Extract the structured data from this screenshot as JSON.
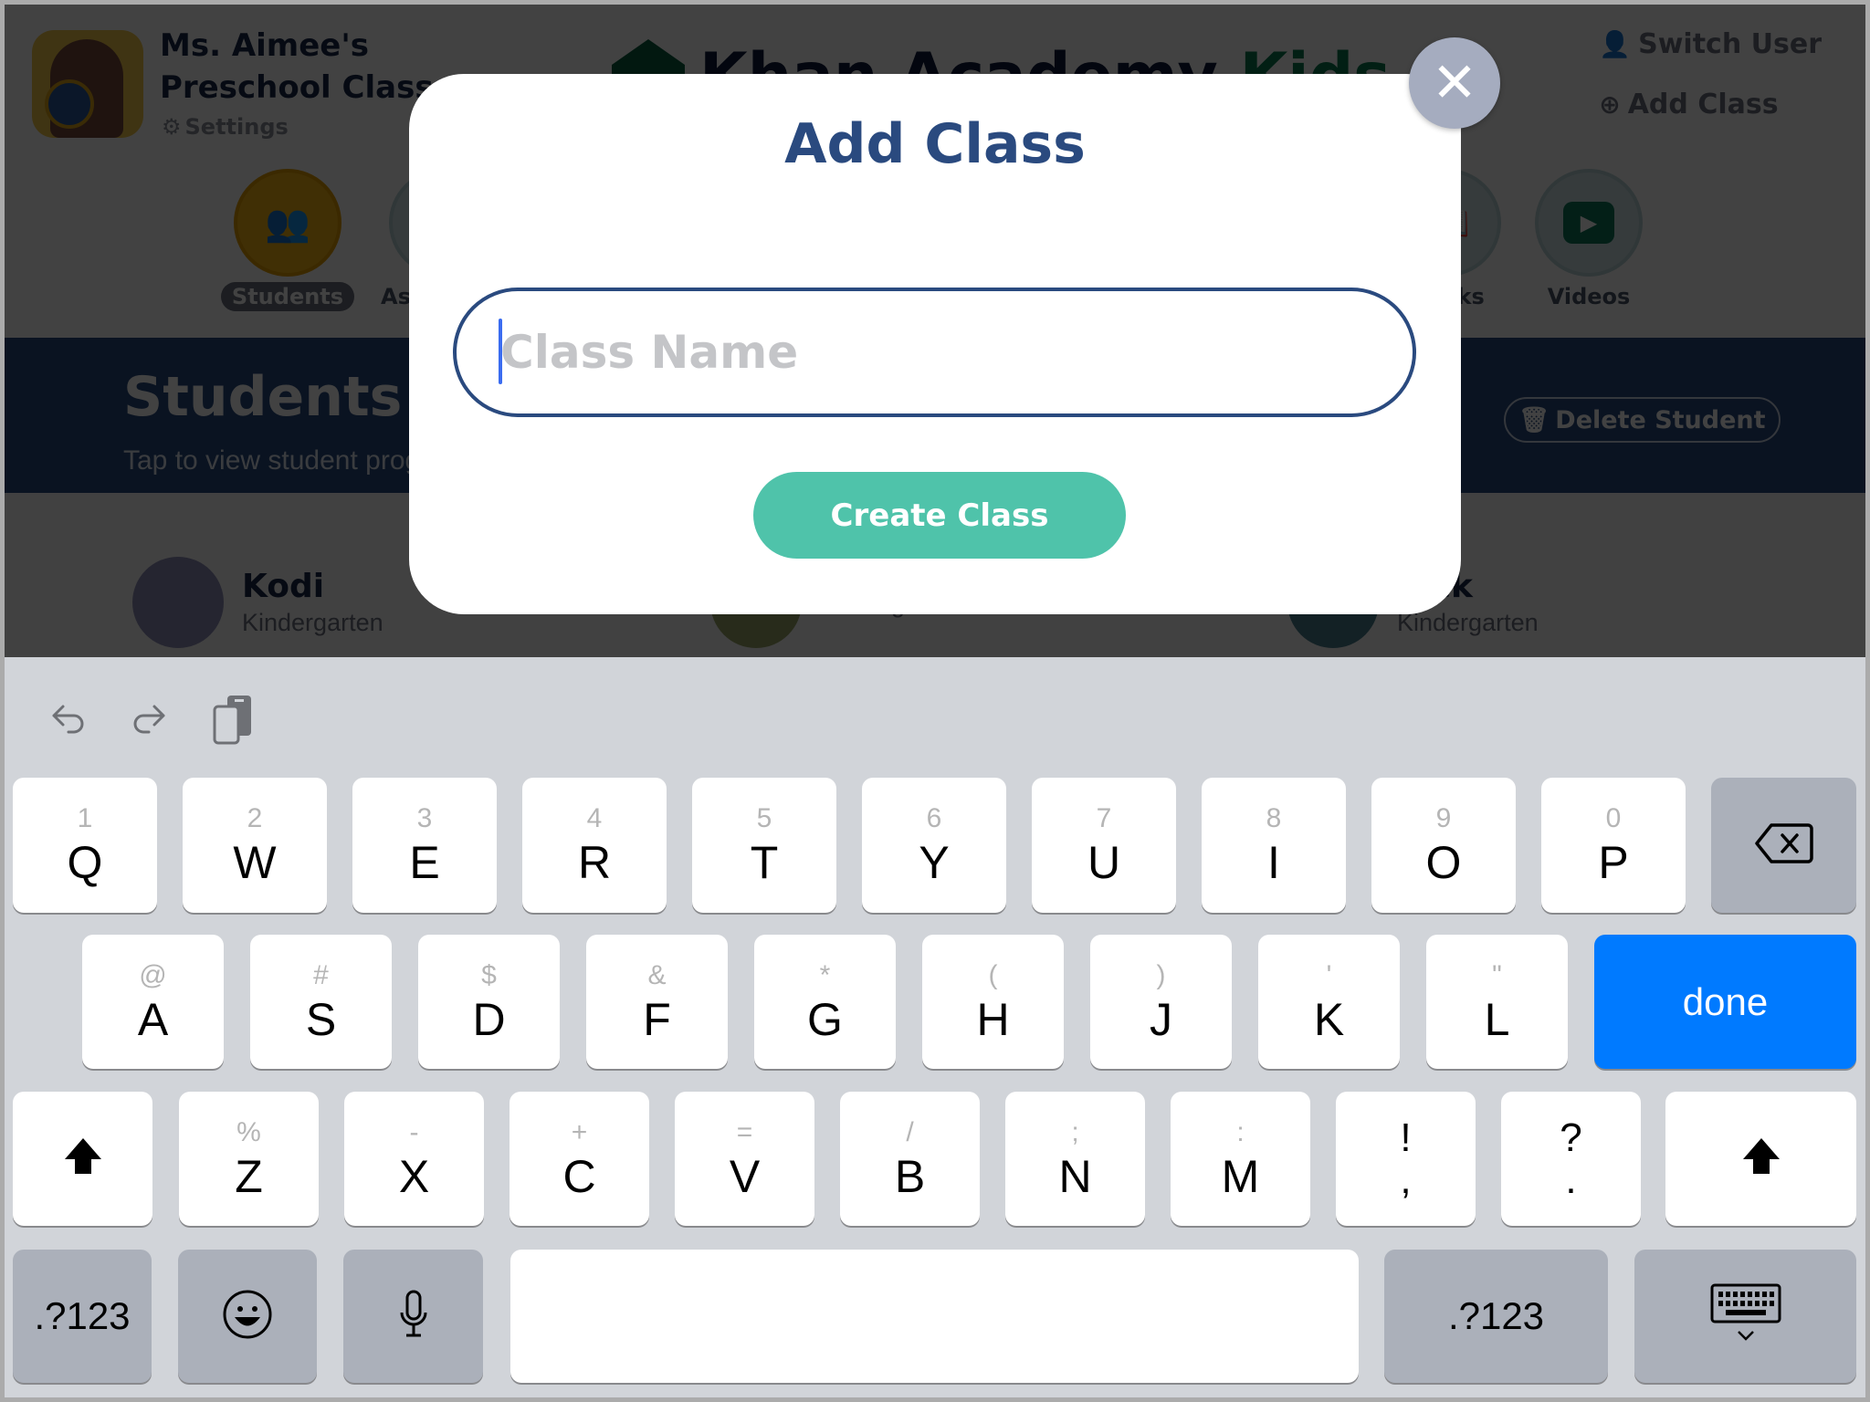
{
  "app": {
    "class_name_line1": "Ms. Aimee's",
    "class_name_line2": "Preschool Class",
    "settings_label": "Settings",
    "logo_primary": "Khan Academy",
    "logo_secondary": "Kids",
    "switch_user_label": "Switch User",
    "add_class_label": "Add Class",
    "nav_tabs": [
      {
        "label": "Students",
        "icon": "students-icon",
        "active": true
      },
      {
        "label": "Assignments",
        "icon": "assignments-icon",
        "active": false
      },
      {
        "label": "Books",
        "icon": "books-icon",
        "active": false
      },
      {
        "label": "Videos",
        "icon": "video-icon",
        "active": false
      }
    ],
    "banner_title": "Students",
    "banner_subtitle": "Tap to view student progress",
    "delete_student_label": "Delete Student",
    "students": [
      {
        "name": "Kodi",
        "grade": "Kindergarten"
      },
      {
        "name": "",
        "grade": "Kindergarten"
      },
      {
        "name": "Jack",
        "grade": "Kindergarten"
      }
    ]
  },
  "dialog": {
    "title": "Add Class",
    "input_value": "",
    "input_placeholder": "Class Name",
    "create_label": "Create Class",
    "close_icon": "close-icon"
  },
  "keyboard": {
    "toolbar": [
      "undo-icon",
      "redo-icon",
      "paste-icon"
    ],
    "row1": [
      {
        "main": "Q",
        "alt": "1"
      },
      {
        "main": "W",
        "alt": "2"
      },
      {
        "main": "E",
        "alt": "3"
      },
      {
        "main": "R",
        "alt": "4"
      },
      {
        "main": "T",
        "alt": "5"
      },
      {
        "main": "Y",
        "alt": "6"
      },
      {
        "main": "U",
        "alt": "7"
      },
      {
        "main": "I",
        "alt": "8"
      },
      {
        "main": "O",
        "alt": "9"
      },
      {
        "main": "P",
        "alt": "0"
      }
    ],
    "row2": [
      {
        "main": "A",
        "alt": "@"
      },
      {
        "main": "S",
        "alt": "#"
      },
      {
        "main": "D",
        "alt": "$"
      },
      {
        "main": "F",
        "alt": "&"
      },
      {
        "main": "G",
        "alt": "*"
      },
      {
        "main": "H",
        "alt": "("
      },
      {
        "main": "J",
        "alt": ")"
      },
      {
        "main": "K",
        "alt": "'"
      },
      {
        "main": "L",
        "alt": "\""
      }
    ],
    "row3": [
      {
        "main": "Z",
        "alt": "%"
      },
      {
        "main": "X",
        "alt": "-"
      },
      {
        "main": "C",
        "alt": "+"
      },
      {
        "main": "V",
        "alt": "="
      },
      {
        "main": "B",
        "alt": "/"
      },
      {
        "main": "N",
        "alt": ";"
      },
      {
        "main": "M",
        "alt": ":"
      }
    ],
    "punct": [
      {
        "top": "!",
        "bottom": ","
      },
      {
        "top": "?",
        "bottom": "."
      }
    ],
    "done_label": "done",
    "numbers_label": ".?123",
    "space_label": ""
  }
}
